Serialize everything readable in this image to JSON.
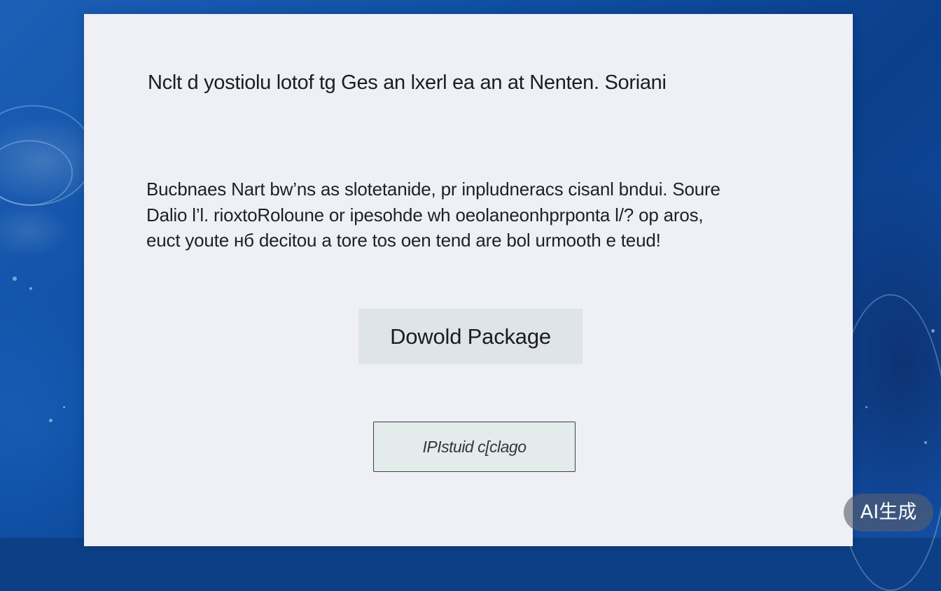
{
  "dialog": {
    "title": "Nclt d  yostiolu lotof tg Ges an lxerl ea an at Nenten. Soriani",
    "body_lines": [
      "Bucbnaes Nart bw’ns as slotetanide, pr inpludneracs cisanl bndui. Soure",
      "Dalio l’l. rioxtoRoloune or ipesohde  wh oeolaneonhprponta l/? op aros,",
      "euct  youte  нб decitou a tore  tos oen tend are bol urmooth e teud!"
    ],
    "primary_button_label": "Dowold Package",
    "secondary_button_label": "IPIstuid c[clago"
  },
  "watermark": {
    "text": "AI生成"
  },
  "colors": {
    "wallpaper": "#0f4fa3",
    "card_background": "#eef0f6",
    "primary_button_background": "#dfe3ea",
    "secondary_button_background": "#e3eceb"
  }
}
